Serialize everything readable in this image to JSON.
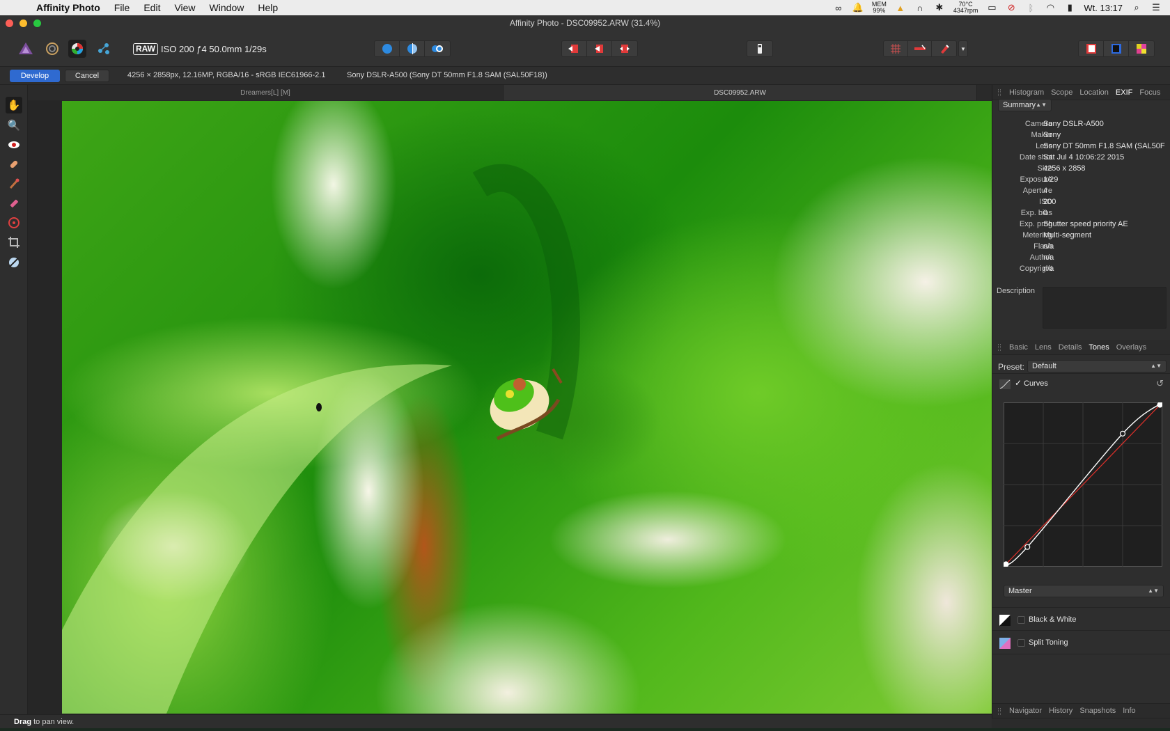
{
  "menubar": {
    "app_name": "Affinity Photo",
    "menus": [
      "File",
      "Edit",
      "View",
      "Window",
      "Help"
    ],
    "mem_label": "MEM",
    "mem_value": "99%",
    "temp": "70°C",
    "rpm": "4347rpm",
    "clock": "Wt. 13:17"
  },
  "window": {
    "title": "Affinity Photo - DSC09952.ARW (31.4%)"
  },
  "toolbar": {
    "raw_badge": "RAW",
    "raw_info": "ISO 200 ƒ4 50.0mm 1/29s"
  },
  "context": {
    "develop_label": "Develop",
    "cancel_label": "Cancel",
    "image_info": "4256 × 2858px, 12.16MP, RGBA/16 - sRGB IEC61966-2.1",
    "camera_info": "Sony DSLR-A500 (Sony DT 50mm F1.8 SAM (SAL50F18))"
  },
  "doc_tabs": [
    "Dreamers[L] [M]",
    "DSC09952.ARW"
  ],
  "panel_top": {
    "tabs": [
      "Histogram",
      "Scope",
      "Location",
      "EXIF",
      "Focus"
    ],
    "active_tab": "EXIF",
    "summary_select": "Summary",
    "exif": [
      {
        "k": "Camera",
        "v": "Sony DSLR-A500"
      },
      {
        "k": "Maker",
        "v": "Sony"
      },
      {
        "k": "Lens",
        "v": "Sony DT 50mm F1.8 SAM (SAL50F"
      },
      {
        "k": "Date shot",
        "v": "Sat Jul  4 10:06:22 2015"
      },
      {
        "k": "Size",
        "v": "4256 x 2858"
      },
      {
        "k": "Exposure",
        "v": "1/29"
      },
      {
        "k": "Aperture",
        "v": "4"
      },
      {
        "k": "ISO",
        "v": "200"
      },
      {
        "k": "Exp. bias",
        "v": "0"
      },
      {
        "k": "Exp. prog",
        "v": "Shutter speed priority AE"
      },
      {
        "k": "Metering",
        "v": "Multi-segment"
      },
      {
        "k": "Flash",
        "v": "n/a"
      },
      {
        "k": "Author",
        "v": "n/a"
      },
      {
        "k": "Copyright",
        "v": "n/a"
      }
    ],
    "description_label": "Description"
  },
  "panel_mid": {
    "tabs": [
      "Basic",
      "Lens",
      "Details",
      "Tones",
      "Overlays"
    ],
    "active_tab": "Tones",
    "preset_label": "Preset:",
    "preset_value": "Default",
    "curves_label": "Curves",
    "curves_check": "✓",
    "channel_value": "Master",
    "curve_points": [
      [
        0,
        0
      ],
      [
        0.15,
        0.12
      ],
      [
        0.75,
        0.81
      ],
      [
        1,
        1
      ]
    ],
    "bw_label": "Black & White",
    "split_label": "Split Toning"
  },
  "panel_bottom": {
    "tabs": [
      "Navigator",
      "History",
      "Snapshots",
      "Info"
    ]
  },
  "status": {
    "bold": "Drag",
    "rest": " to pan view."
  },
  "colors": {
    "accent": "#2f6ad0",
    "curve_white": "#ffffff",
    "curve_red": "#e0302a"
  }
}
